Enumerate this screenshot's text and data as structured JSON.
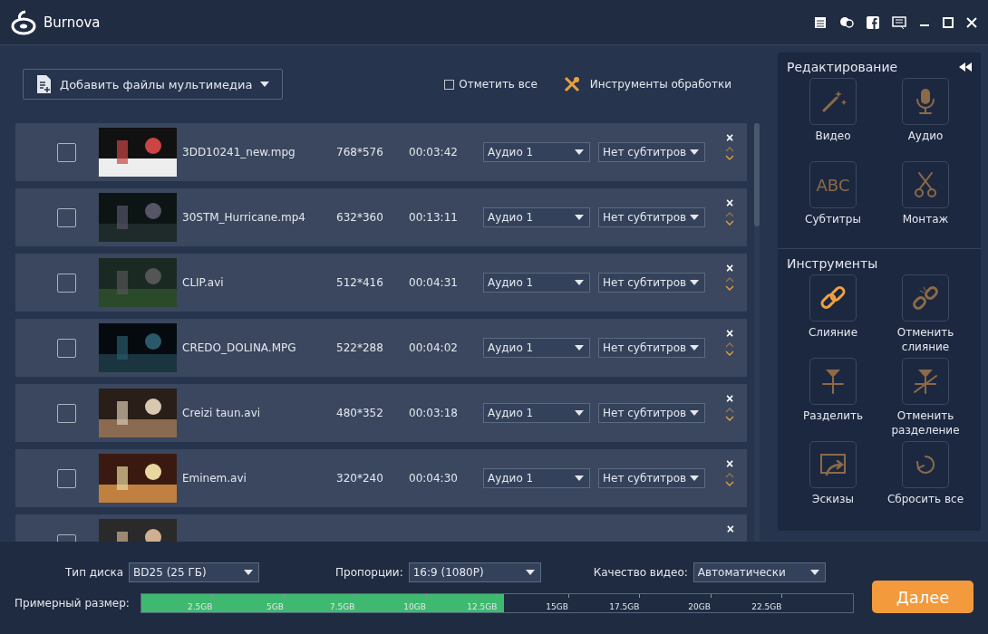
{
  "window": {
    "title": "Burnova"
  },
  "toolbar": {
    "add_button": "Добавить файлы мультимедиа",
    "select_all": {
      "label": "Отметить все",
      "checked": false
    },
    "tools_button": "Инструменты обработки"
  },
  "files": [
    {
      "name": "3DD10241_new.mpg",
      "resolution": "768*576",
      "duration": "00:03:42",
      "audio": "Аудио 1",
      "subtitles": "Нет субтитров",
      "checked": false
    },
    {
      "name": "30STM_Hurricane.mp4",
      "resolution": "632*360",
      "duration": "00:13:11",
      "audio": "Аудио 1",
      "subtitles": "Нет субтитров",
      "checked": false
    },
    {
      "name": "CLIP.avi",
      "resolution": "512*416",
      "duration": "00:04:31",
      "audio": "Аудио 1",
      "subtitles": "Нет субтитров",
      "checked": false
    },
    {
      "name": "CREDO_DOLINA.MPG",
      "resolution": "522*288",
      "duration": "00:04:02",
      "audio": "Аудио 1",
      "subtitles": "Нет субтитров",
      "checked": false
    },
    {
      "name": "Creizi taun.avi",
      "resolution": "480*352",
      "duration": "00:03:18",
      "audio": "Аудио 1",
      "subtitles": "Нет субтитров",
      "checked": false
    },
    {
      "name": "Eminem.avi",
      "resolution": "320*240",
      "duration": "00:04:30",
      "audio": "Аудио 1",
      "subtitles": "Нет субтитров",
      "checked": false
    },
    {
      "checked": false
    }
  ],
  "remove_mark": "×",
  "side_panel": {
    "sections": [
      {
        "title": "Редактирование",
        "tools": [
          {
            "kind": "wand",
            "label": "Видео",
            "disabled": true
          },
          {
            "kind": "mic",
            "label": "Аудио",
            "disabled": true
          },
          {
            "kind": "abc",
            "icon_text": "ABC",
            "label": "Субтитры",
            "disabled": true
          },
          {
            "kind": "scissors",
            "label": "Монтаж",
            "disabled": true
          }
        ]
      },
      {
        "title": "Инструменты",
        "tools": [
          {
            "kind": "link",
            "label": "Слияние",
            "disabled": false
          },
          {
            "kind": "unlink",
            "label": "Отменить слияние",
            "disabled": true
          },
          {
            "kind": "split",
            "label": "Разделить",
            "disabled": true
          },
          {
            "kind": "unsplit",
            "label": "Отменить разделение",
            "disabled": true
          },
          {
            "kind": "thumb",
            "label": "Эскизы",
            "disabled": true
          },
          {
            "kind": "reset",
            "label": "Сбросить все",
            "disabled": true
          }
        ]
      }
    ]
  },
  "bottom": {
    "disc_type": {
      "label": "Тип диска",
      "value": "BD25 (25 ГБ)"
    },
    "aspect": {
      "label": "Пропорции:",
      "value": "16:9 (1080P)"
    },
    "quality": {
      "label": "Качество видео:",
      "value": "Автоматически"
    },
    "size": {
      "label": "Примерный размер:",
      "level": 0.51,
      "ticks": [
        "2.5GB",
        "5GB",
        "7.5GB",
        "10GB",
        "12.5GB",
        "15GB",
        "17.5GB",
        "20GB",
        "22.5GB"
      ]
    },
    "next_button": "Далее"
  }
}
